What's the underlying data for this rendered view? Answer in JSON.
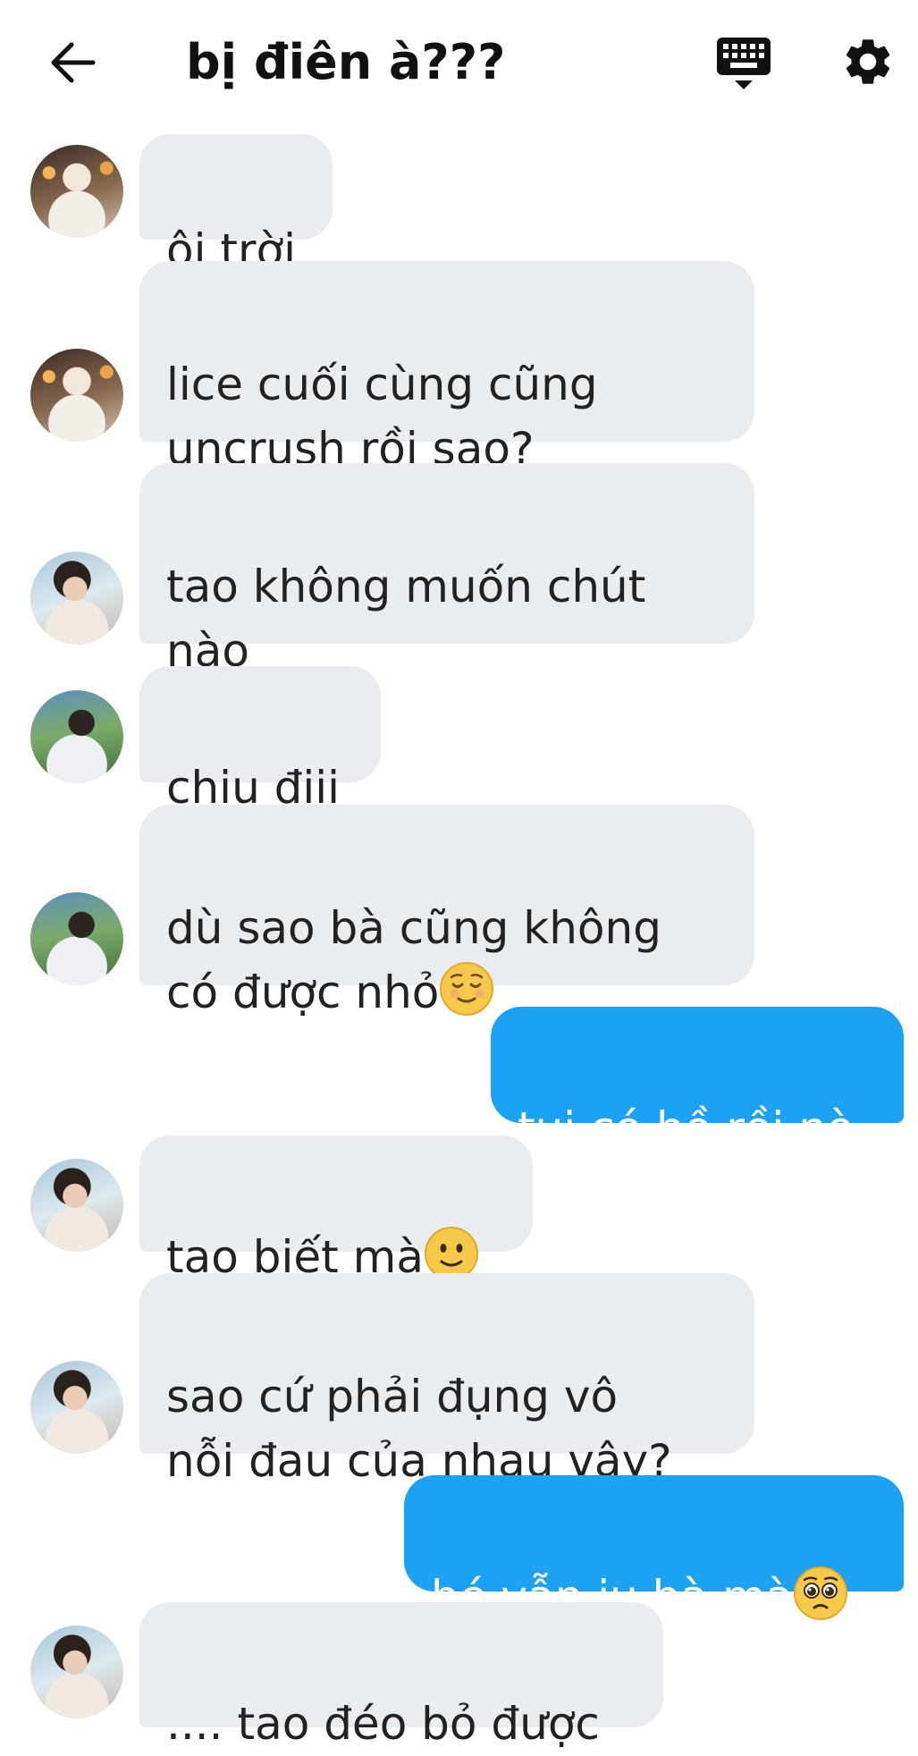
{
  "header": {
    "title": "bị điên à???",
    "icons": [
      "arrow-left-icon",
      "keyboard-icon",
      "gear-icon"
    ]
  },
  "messages": [
    {
      "dir": "in",
      "avatar": "a",
      "text": "ôi trời"
    },
    {
      "dir": "in",
      "avatar": "a",
      "text": "lice cuối cùng cũng\nuncrush rồi sao?"
    },
    {
      "dir": "in",
      "avatar": "b",
      "text": "tao không muốn chút\nnào"
    },
    {
      "dir": "in",
      "avatar": "c",
      "text": "chịu điii"
    },
    {
      "dir": "in",
      "avatar": "c",
      "text": "dù sao bà cũng không\ncó được nhỏ",
      "emoji": "relieved-face-icon"
    },
    {
      "dir": "out",
      "text": "tui có bồ rồi nò"
    },
    {
      "dir": "in",
      "avatar": "b",
      "text": "tao biết mà",
      "emoji": "slightly-smiling-face-icon"
    },
    {
      "dir": "in",
      "avatar": "b",
      "text": "sao cứ phải đụng vô\nnỗi đau của nhau vậy?"
    },
    {
      "dir": "out",
      "text": "bé vẫn iu bà mà",
      "emoji": "pleading-face-icon"
    },
    {
      "dir": "in",
      "avatar": "b",
      "text": ".... tao đéo bỏ được"
    }
  ],
  "colors": {
    "incoming_bubble": "#e9edf0",
    "outgoing_bubble": "#1da1f2",
    "outgoing_text": "#ffffff",
    "title_text": "#111111"
  }
}
